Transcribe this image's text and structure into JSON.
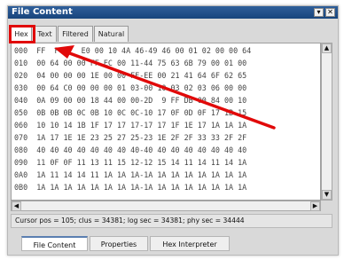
{
  "window": {
    "title": "File Content",
    "dropdown_glyph": "▾",
    "close_glyph": "✕"
  },
  "tabs": [
    "Hex",
    "Text",
    "Filtered",
    "Natural"
  ],
  "hex": [
    {
      "offset": "000",
      "bytes": "FF  F  F  E0 00 10 4A 46-49 46 00 01 02 00 00 64"
    },
    {
      "offset": "010",
      "bytes": "00 64 00 00 FF EC 00 11-44 75 63 6B 79 00 01 00"
    },
    {
      "offset": "020",
      "bytes": "04 00 00 00 1E 00 00 FF-EE 00 21 41 64 6F 62 65"
    },
    {
      "offset": "030",
      "bytes": "00 64 C0 00 00 00 01 03-00 10 03 02 03 06 00 00"
    },
    {
      "offset": "040",
      "bytes": "0A 09 00 00 18 44 00 00-2D  9 FF DB 00 84 00 10"
    },
    {
      "offset": "050",
      "bytes": "0B 0B 0B 0C 0B 10 0C 0C-10 17 0F 0D 0F 17 1B 15"
    },
    {
      "offset": "060",
      "bytes": "10 10 14 1B 1F 17 17 17-17 17 1F 1E 17 1A 1A 1A"
    },
    {
      "offset": "070",
      "bytes": "1A 17 1E 1E 23 25 27 25-23 1E 2F 2F 33 33 2F 2F"
    },
    {
      "offset": "080",
      "bytes": "40 40 40 40 40 40 40 40-40 40 40 40 40 40 40 40"
    },
    {
      "offset": "090",
      "bytes": "11 0F 0F 11 13 11 15 12-12 15 14 11 14 11 14 1A"
    },
    {
      "offset": "0A0",
      "bytes": "1A 11 14 14 11 1A 1A 1A-1A 1A 1A 1A 1A 1A 1A 1A"
    },
    {
      "offset": "0B0",
      "bytes": "1A 1A 1A 1A 1A 1A 1A 1A-1A 1A 1A 1A 1A 1A 1A 1A"
    }
  ],
  "scroll": {
    "up": "▲",
    "down": "▼",
    "left": "◀",
    "right": "▶"
  },
  "status": "Cursor pos = 105; clus = 34381; log sec = 34381; phy sec = 34444",
  "bottom_tabs": [
    "File Content",
    "Properties",
    "Hex Interpreter"
  ],
  "colors": {
    "highlight": "#e10909",
    "title_bar": "#1e4f88"
  }
}
